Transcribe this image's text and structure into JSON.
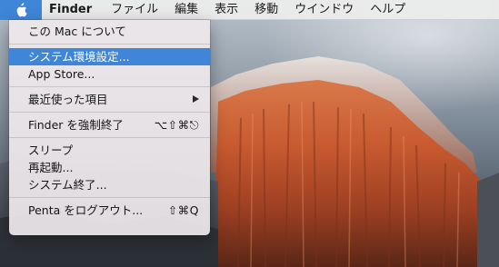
{
  "menubar": {
    "apple_icon": "apple-logo-icon",
    "items": [
      {
        "label": "Finder"
      },
      {
        "label": "ファイル"
      },
      {
        "label": "編集"
      },
      {
        "label": "表示"
      },
      {
        "label": "移動"
      },
      {
        "label": "ウインドウ"
      },
      {
        "label": "ヘルプ"
      }
    ]
  },
  "apple_menu": {
    "highlighted_item": "システム環境設定...",
    "accent_color": "#3f86d8",
    "items": [
      {
        "label": "この Mac について"
      },
      {
        "label": "システム環境設定..."
      },
      {
        "label": "App Store..."
      },
      {
        "label": "最近使った項目",
        "submenu_icon": "chevron-right-icon"
      },
      {
        "label": "Finder を強制終了",
        "shortcut": "⌥⇧⌘⎋"
      },
      {
        "label": "スリープ"
      },
      {
        "label": "再起動..."
      },
      {
        "label": "システム終了..."
      },
      {
        "label": "Penta をログアウト...",
        "shortcut": "⇧⌘Q"
      }
    ]
  }
}
